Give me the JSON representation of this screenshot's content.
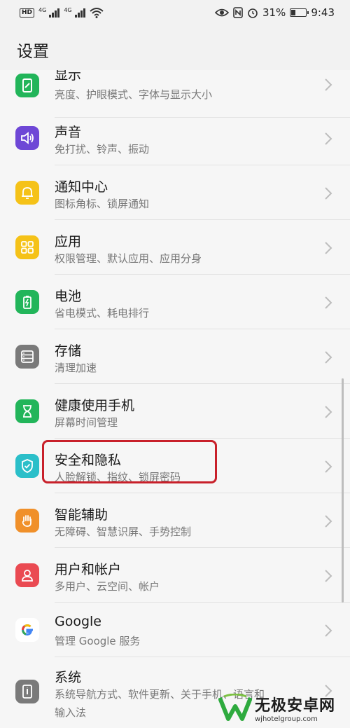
{
  "status_bar": {
    "hd": "HD",
    "net1": "4G",
    "net2": "4G",
    "battery": "31%",
    "battery_level": 0.31,
    "time": "9:43"
  },
  "header": {
    "title": "设置"
  },
  "items": [
    {
      "title": "显示",
      "subtitle": "亮度、护眼模式、字体与显示大小",
      "icon": "display-icon",
      "color": "#22b55a"
    },
    {
      "title": "声音",
      "subtitle": "免打扰、铃声、振动",
      "icon": "sound-icon",
      "color": "#6e47d6"
    },
    {
      "title": "通知中心",
      "subtitle": "图标角标、锁屏通知",
      "icon": "bell-icon",
      "color": "#f5c218"
    },
    {
      "title": "应用",
      "subtitle": "权限管理、默认应用、应用分身",
      "icon": "apps-grid-icon",
      "color": "#f5c218"
    },
    {
      "title": "电池",
      "subtitle": "省电模式、耗电排行",
      "icon": "battery-icon",
      "color": "#22b55a"
    },
    {
      "title": "存储",
      "subtitle": "清理加速",
      "icon": "storage-icon",
      "color": "#7a7a7a"
    },
    {
      "title": "健康使用手机",
      "subtitle": "屏幕时间管理",
      "icon": "hourglass-icon",
      "color": "#22b55a"
    },
    {
      "title": "安全和隐私",
      "subtitle": "人脸解锁、指纹、锁屏密码",
      "icon": "shield-icon",
      "color": "#2bbfc9"
    },
    {
      "title": "智能辅助",
      "subtitle": "无障碍、智慧识屏、手势控制",
      "icon": "hand-icon",
      "color": "#f0902a"
    },
    {
      "title": "用户和帐户",
      "subtitle": "多用户、云空间、帐户",
      "icon": "user-icon",
      "color": "#ea4a52"
    },
    {
      "title": "Google",
      "subtitle": "管理 Google 服务",
      "icon": "google-icon",
      "color": "#ffffff"
    },
    {
      "title": "系统",
      "subtitle": "系统导航方式、软件更新、关于手机、语言和",
      "subtitle2": "输入法",
      "icon": "system-icon",
      "color": "#7a7a7a"
    }
  ],
  "watermark": {
    "title": "无极安卓网",
    "url": "wjhotelgroup.com"
  }
}
